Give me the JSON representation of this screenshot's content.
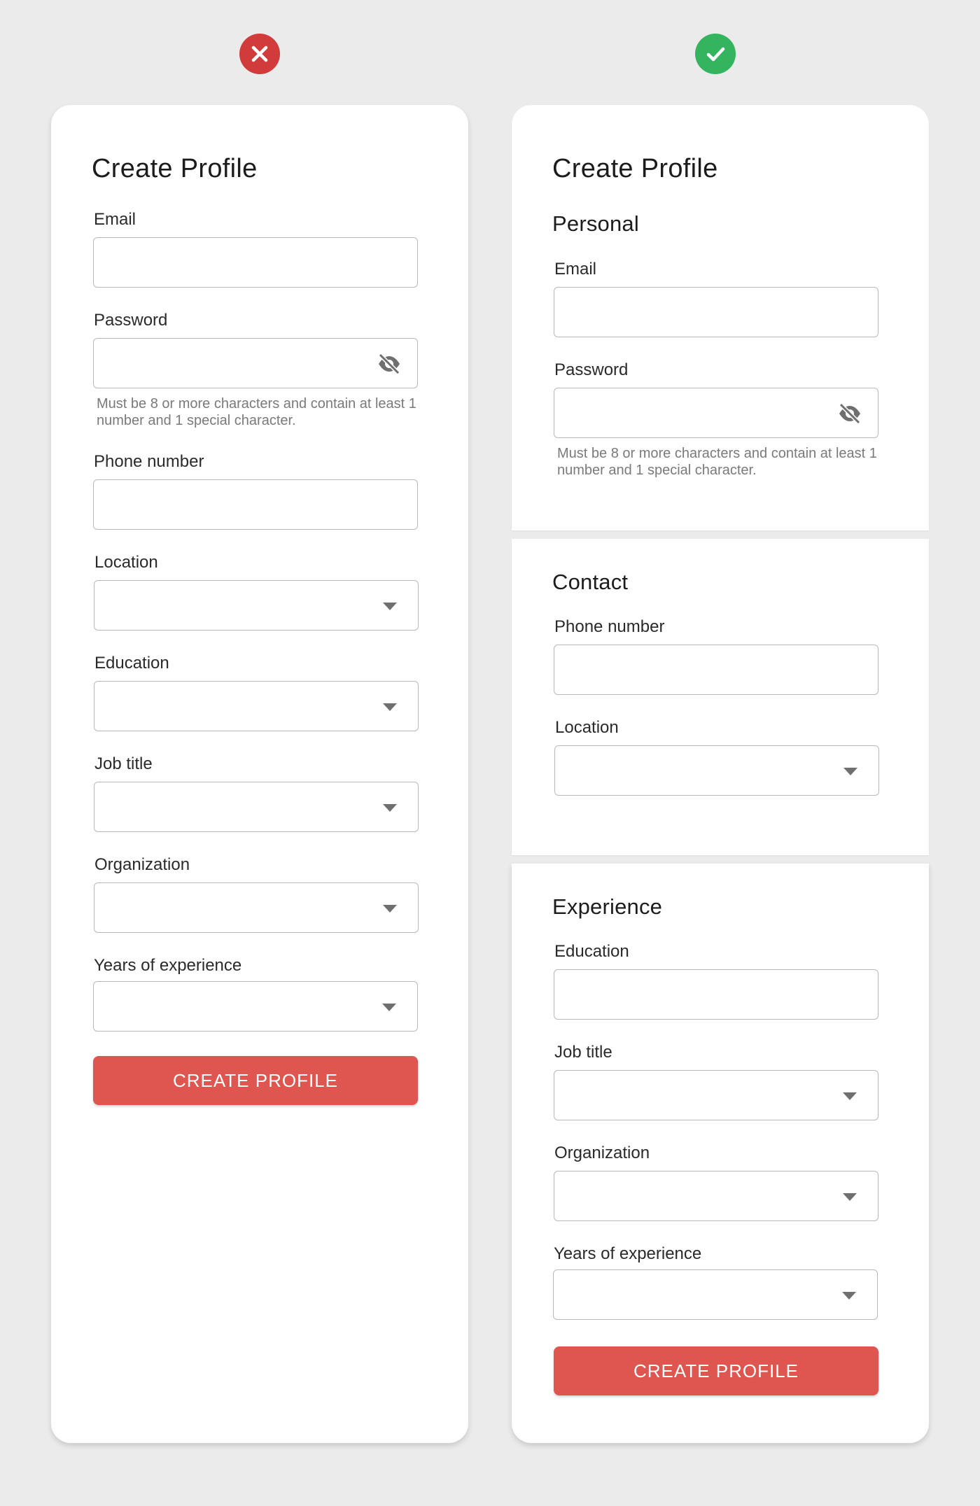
{
  "colors": {
    "bad": "#d23b3b",
    "good": "#35b45f",
    "button": "#df5550",
    "background": "#ebebeb"
  },
  "badges": {
    "bad_icon": "x-icon",
    "good_icon": "check-icon"
  },
  "left": {
    "title": "Create Profile",
    "fields": {
      "email": "Email",
      "password": "Password",
      "password_help": "Must be 8 or more characters and contain at least 1 number and 1 special character.",
      "phone": "Phone number",
      "location": "Location",
      "education": "Education",
      "job_title": "Job title",
      "organization": "Organization",
      "years": "Years of experience"
    },
    "button": "CREATE PROFILE"
  },
  "right": {
    "title": "Create Profile",
    "sections": {
      "personal": "Personal",
      "contact": "Contact",
      "experience": "Experience"
    },
    "fields": {
      "email": "Email",
      "password": "Password",
      "password_help": "Must be 8 or more characters and contain at least 1 number and 1 special character.",
      "phone": "Phone number",
      "location": "Location",
      "education": "Education",
      "job_title": "Job title",
      "organization": "Organization",
      "years": "Years of experience"
    },
    "button": "CREATE PROFILE"
  }
}
